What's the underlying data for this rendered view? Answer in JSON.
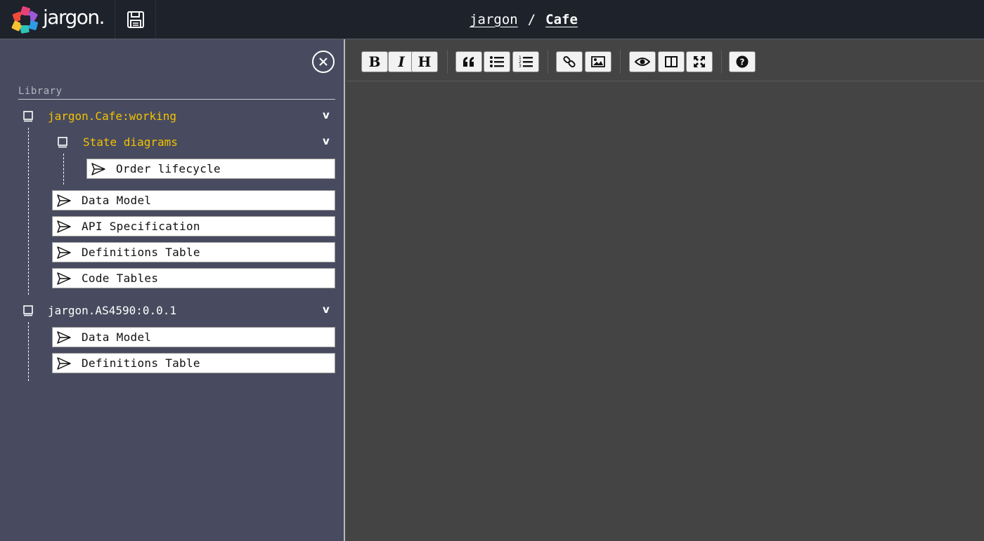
{
  "app": {
    "name": "jargon.",
    "breadcrumb": {
      "root": "jargon",
      "separator": "/",
      "current": "Cafe"
    }
  },
  "colors": {
    "topbar": "#1e222b",
    "sidebar": "#484b5f",
    "editor": "#444444",
    "highlight": "#f2c200",
    "text": "#ffffff"
  },
  "sidebar": {
    "section_label": "Library",
    "close_icon": "close-circle-icon",
    "libraries": [
      {
        "name": "jargon.Cafe:working",
        "highlighted": true,
        "expanded": true,
        "folders": [
          {
            "name": "State diagrams",
            "highlighted": true,
            "expanded": true,
            "items": [
              "Order lifecycle"
            ]
          }
        ],
        "items": [
          "Data Model",
          "API Specification",
          "Definitions Table",
          "Code Tables"
        ]
      },
      {
        "name": "jargon.AS4590:0.0.1",
        "highlighted": false,
        "expanded": true,
        "items": [
          "Data Model",
          "Definitions Table"
        ]
      }
    ],
    "chevron": "v"
  },
  "toolbar": {
    "bold": "B",
    "italic": "I",
    "heading": "H",
    "icons": [
      "bold-icon",
      "italic-icon",
      "heading-icon",
      "quote-icon",
      "unordered-list-icon",
      "ordered-list-icon",
      "link-icon",
      "image-icon",
      "preview-icon",
      "side-by-side-icon",
      "fullscreen-icon",
      "help-icon"
    ]
  }
}
